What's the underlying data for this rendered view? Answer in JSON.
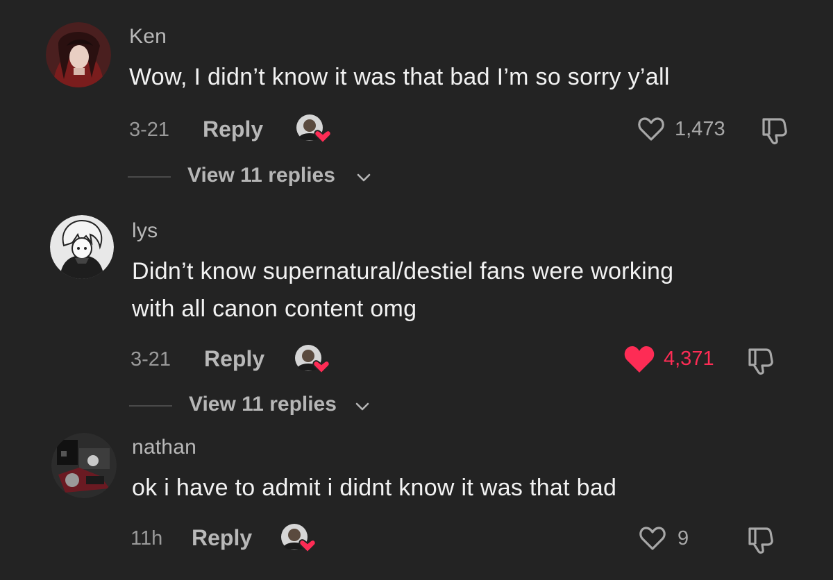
{
  "comments": [
    {
      "username": "Ken",
      "text_lines": [
        "Wow, I didn’t know it was that bad I’m so sorry y’all"
      ],
      "date": "3-21",
      "reply_label": "Reply",
      "likes": "1,473",
      "liked": false,
      "view_replies": "View 11 replies"
    },
    {
      "username": "lys",
      "text_lines": [
        "Didn’t know supernatural/destiel fans were working",
        "with all canon content omg"
      ],
      "date": "3-21",
      "reply_label": "Reply",
      "likes": "4,371",
      "liked": true,
      "view_replies": "View 11 replies"
    },
    {
      "username": "nathan",
      "text_lines": [
        "ok i have to admit i didnt know it was that bad"
      ],
      "date": "11h",
      "reply_label": "Reply",
      "likes": "9",
      "liked": false
    }
  ],
  "colors": {
    "background": "#232323",
    "liked_red": "#fe2c55",
    "muted_text": "#9a9a9a"
  },
  "icons": {
    "like": "heart-icon",
    "dislike": "thumbs-down-icon",
    "creator_liked": "creator-heart-avatar-icon",
    "expand": "chevron-down-icon"
  }
}
